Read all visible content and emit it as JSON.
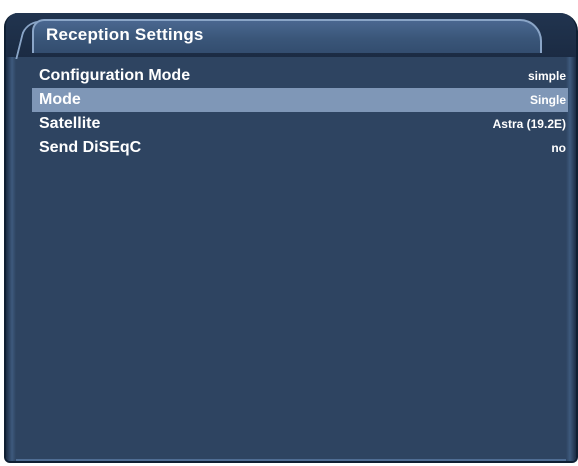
{
  "window": {
    "title": "Reception Settings"
  },
  "settings": [
    {
      "label": "Configuration Mode",
      "value": "simple",
      "selected": false
    },
    {
      "label": "Mode",
      "value": "Single",
      "selected": true
    },
    {
      "label": "Satellite",
      "value": "Astra (19.2E)",
      "selected": false
    },
    {
      "label": "Send DiSEqC",
      "value": "no",
      "selected": false
    }
  ],
  "colors": {
    "background": "#2e4461",
    "selection": "#7f97b7",
    "title_tab": "#3a5679",
    "text": "#ffffff"
  }
}
